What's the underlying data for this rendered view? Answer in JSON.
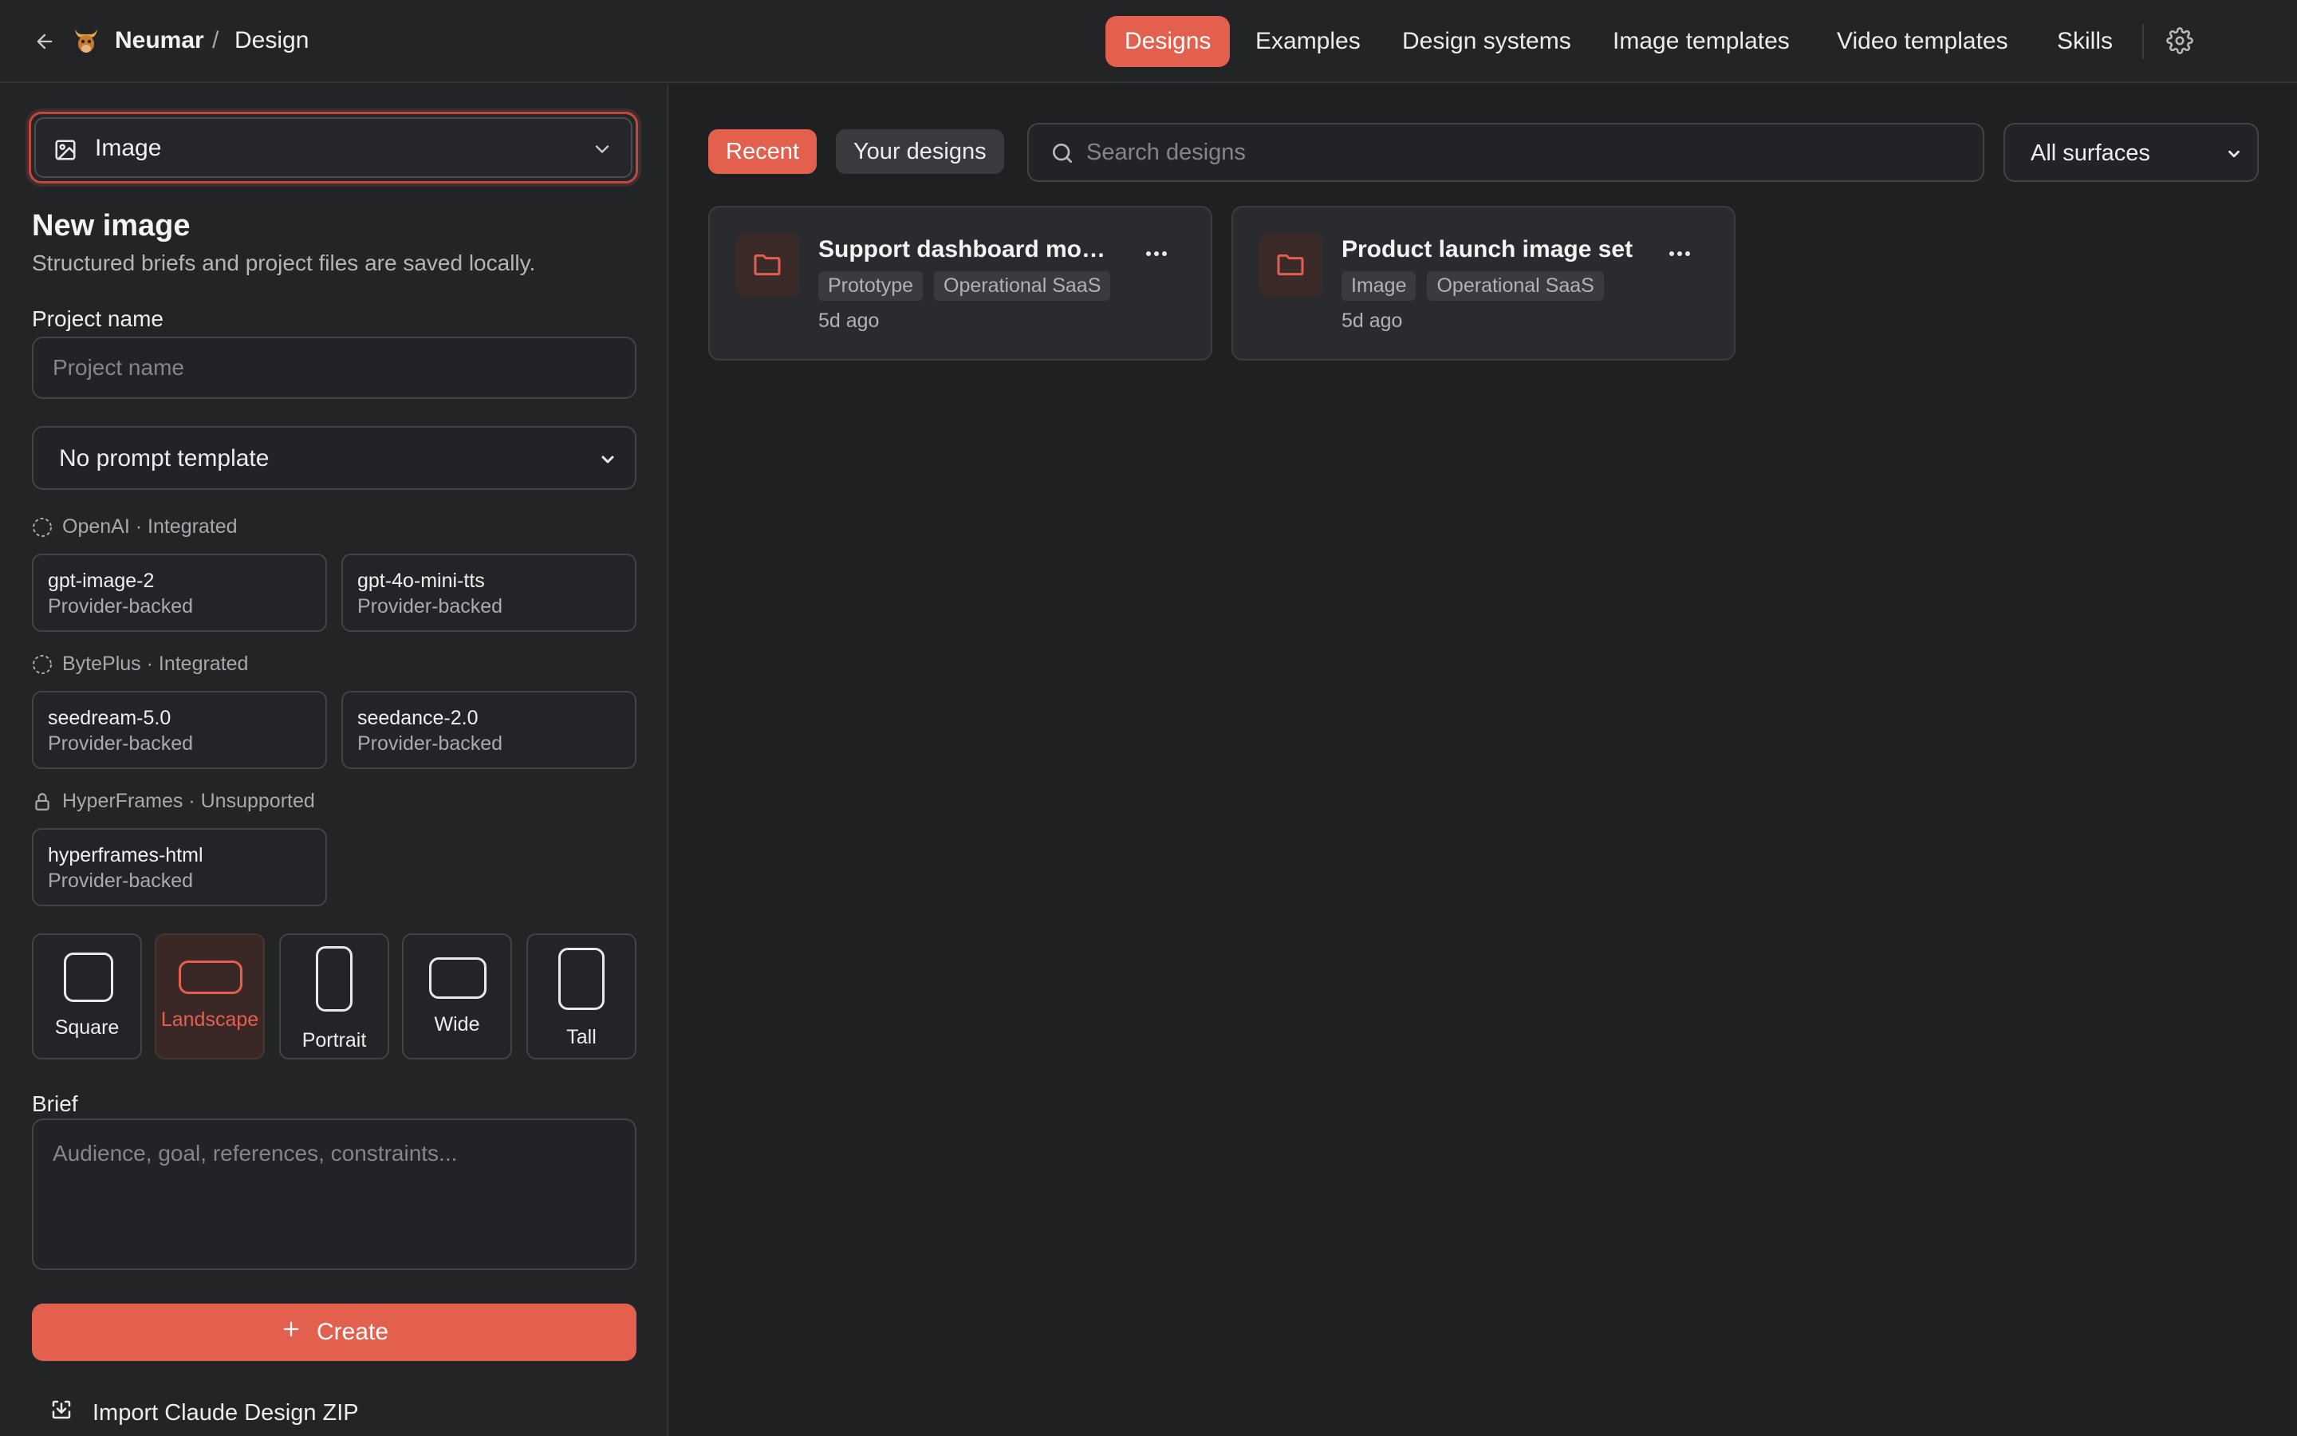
{
  "header": {
    "app_name": "Neumar",
    "separator": "/",
    "page": "Design",
    "nav": [
      {
        "label": "Designs",
        "active": true
      },
      {
        "label": "Examples"
      },
      {
        "label": "Design systems"
      },
      {
        "label": "Image templates"
      },
      {
        "label": "Video templates"
      },
      {
        "label": "Skills"
      }
    ]
  },
  "sidebar": {
    "type_select": "Image",
    "heading": "New image",
    "subheading": "Structured briefs and project files are saved locally.",
    "project_name_label": "Project name",
    "project_name_placeholder": "Project name",
    "template_select": "No prompt template",
    "providers": [
      {
        "name": "OpenAI · Integrated",
        "icon": "dashed-circle-icon",
        "models": [
          {
            "name": "gpt-image-2",
            "tag": "Provider-backed"
          },
          {
            "name": "gpt-4o-mini-tts",
            "tag": "Provider-backed"
          }
        ]
      },
      {
        "name": "BytePlus · Integrated",
        "icon": "dashed-circle-icon",
        "models": [
          {
            "name": "seedream-5.0",
            "tag": "Provider-backed"
          },
          {
            "name": "seedance-2.0",
            "tag": "Provider-backed"
          }
        ]
      },
      {
        "name": "HyperFrames · Unsupported",
        "icon": "lock-icon",
        "models": [
          {
            "name": "hyperframes-html",
            "tag": "Provider-backed"
          }
        ]
      }
    ],
    "aspects": [
      {
        "label": "Square"
      },
      {
        "label": "Landscape",
        "selected": true
      },
      {
        "label": "Portrait"
      },
      {
        "label": "Wide"
      },
      {
        "label": "Tall"
      }
    ],
    "brief_label": "Brief",
    "brief_placeholder": "Audience, goal, references, constraints...",
    "create_label": "Create",
    "import_label": "Import Claude Design ZIP"
  },
  "main": {
    "tabs": [
      {
        "label": "Recent",
        "active": true
      },
      {
        "label": "Your designs"
      }
    ],
    "search_placeholder": "Search designs",
    "surface_filter": "All surfaces",
    "designs": [
      {
        "title": "Support dashboard mockup",
        "tags": [
          "Prototype",
          "Operational SaaS"
        ],
        "time": "5d ago"
      },
      {
        "title": "Product launch image set",
        "tags": [
          "Image",
          "Operational SaaS"
        ],
        "time": "5d ago"
      }
    ]
  },
  "colors": {
    "accent": "#e3604e",
    "background": "#1f2022",
    "panel": "#232426"
  }
}
